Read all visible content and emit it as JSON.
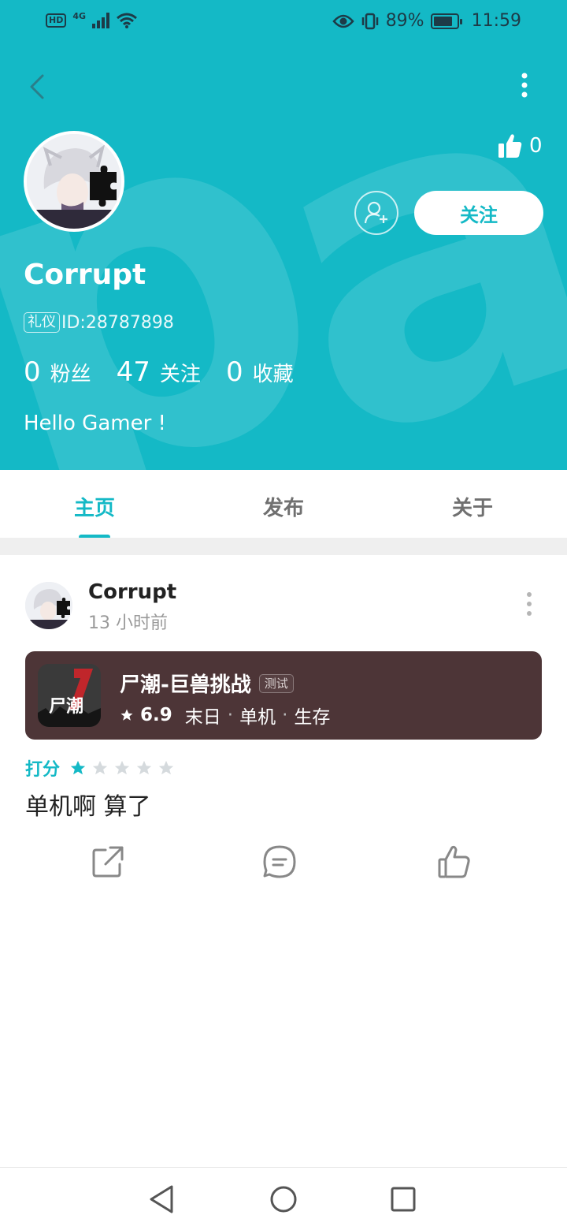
{
  "status_bar": {
    "network": "4G",
    "battery_percent": "89%",
    "time": "11:59"
  },
  "header": {
    "like_count": "0",
    "follow_label": "关注"
  },
  "profile": {
    "name": "Corrupt",
    "tag": "礼仪",
    "id_text": "ID:28787898",
    "stats": [
      {
        "value": "0",
        "label": "粉丝"
      },
      {
        "value": "47",
        "label": "关注"
      },
      {
        "value": "0",
        "label": "收藏"
      }
    ],
    "bio": "Hello Gamer !"
  },
  "tabs": [
    {
      "label": "主页",
      "active": true
    },
    {
      "label": "发布",
      "active": false
    },
    {
      "label": "关于",
      "active": false
    }
  ],
  "post": {
    "author": "Corrupt",
    "time": "13 小时前",
    "game": {
      "icon_text": "尸潮",
      "title": "尸潮-巨兽挑战",
      "badge": "测试",
      "score": "6.9",
      "tags": [
        "末日",
        "单机",
        "生存"
      ]
    },
    "rating_label": "打分",
    "rating_stars": 1,
    "rating_max": 5,
    "content": "单机啊 算了"
  },
  "colors": {
    "accent": "#14b9c6",
    "card": "#4d3537"
  }
}
